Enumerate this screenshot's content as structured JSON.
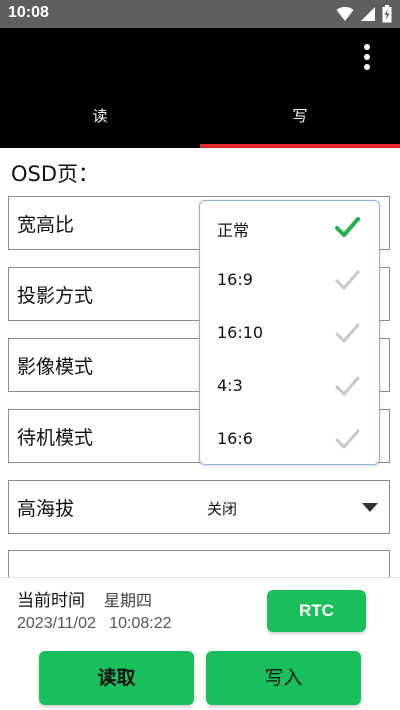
{
  "status_bar": {
    "time": "10:08",
    "icons": [
      "wifi-icon",
      "signal-icon",
      "battery-charging-icon"
    ]
  },
  "app_bar": {
    "overflow_icon": "more-vert-icon",
    "tabs": [
      {
        "label": "读",
        "selected": false
      },
      {
        "label": "写",
        "selected": true
      }
    ],
    "indicator_color": "#e1262d"
  },
  "osd": {
    "section_title": "OSD页：",
    "rows": [
      {
        "label": "宽高比",
        "value": ""
      },
      {
        "label": "投影方式",
        "value": ""
      },
      {
        "label": "影像模式",
        "value": ""
      },
      {
        "label": "待机模式",
        "value": ""
      },
      {
        "label": "高海拔",
        "value": "关闭"
      },
      {
        "label": "",
        "value": ""
      }
    ]
  },
  "dropdown": {
    "options": [
      {
        "label": "正常",
        "selected": true
      },
      {
        "label": "16:9",
        "selected": false
      },
      {
        "label": "16:10",
        "selected": false
      },
      {
        "label": "4:3",
        "selected": false
      },
      {
        "label": "16:6",
        "selected": false
      }
    ],
    "check_color_selected": "#22b14c",
    "check_color_unselected": "#c8c8c8"
  },
  "bottom": {
    "current_time_label": "当前时间",
    "weekday": "星期四",
    "datetime": "2023/11/02   10:08:22",
    "rtc_label": "RTC",
    "read_label": "读取",
    "write_label": "写入",
    "accent": "#19bf5b"
  }
}
